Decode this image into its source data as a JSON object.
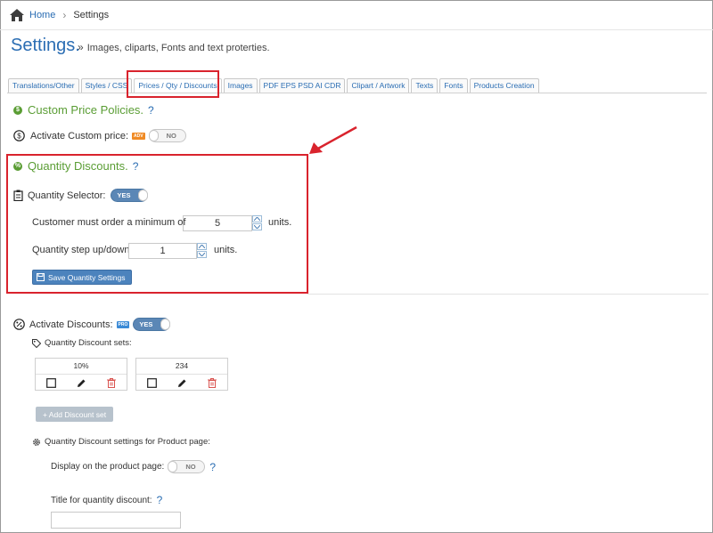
{
  "breadcrumb": {
    "home": "Home",
    "current": "Settings"
  },
  "page": {
    "title": "Settings.",
    "subtitle": "Images, cliparts, Fonts and text proterties."
  },
  "tabs": [
    {
      "label": "Translations/Other"
    },
    {
      "label": "Styles / CSS"
    },
    {
      "label": "Prices / Qty / Discounts",
      "active": true
    },
    {
      "label": "Images"
    },
    {
      "label": "PDF EPS PSD AI CDR"
    },
    {
      "label": "Clipart / Artwork"
    },
    {
      "label": "Texts"
    },
    {
      "label": "Fonts"
    },
    {
      "label": "Products Creation"
    }
  ],
  "custom_price": {
    "title": "Custom Price Policies.",
    "help": "?",
    "activate_label": "Activate Custom price:",
    "badge": "ADV",
    "toggle": "NO"
  },
  "quantity_discounts": {
    "title": "Quantity Discounts.",
    "help": "?",
    "selector_label": "Quantity Selector:",
    "selector_toggle": "YES",
    "min_label": "Customer must order a minimum of",
    "min_value": "5",
    "min_units": "units.",
    "step_label": "Quantity step up/down",
    "step_value": "1",
    "step_units": "units.",
    "save_button": "Save Quantity Settings"
  },
  "discounts": {
    "activate_label": "Activate Discounts:",
    "badge": "PRO",
    "toggle": "YES",
    "sets_label": "Quantity Discount sets:",
    "sets": [
      {
        "name": "10%"
      },
      {
        "name": "234"
      }
    ],
    "add_button": "+ Add Discount set",
    "product_settings_label": "Quantity Discount settings for Product page:",
    "display_label": "Display on the product page:",
    "display_toggle": "NO",
    "display_help": "?",
    "title_label": "Title for quantity discount:",
    "title_help": "?",
    "title_value": ""
  },
  "colors": {
    "accent_blue": "#2a6db3",
    "section_green": "#5a9d34",
    "highlight_red": "#d9232d",
    "toggle_on": "#5b87b6",
    "delete_red": "#d9534f"
  },
  "icons": [
    "home-icon",
    "chevron-right-icon",
    "dollar-circle-icon",
    "percent-circle-icon",
    "clipboard-icon",
    "save-icon",
    "tag-icon",
    "gear-icon",
    "checkbox-icon",
    "pencil-icon",
    "trash-icon"
  ]
}
